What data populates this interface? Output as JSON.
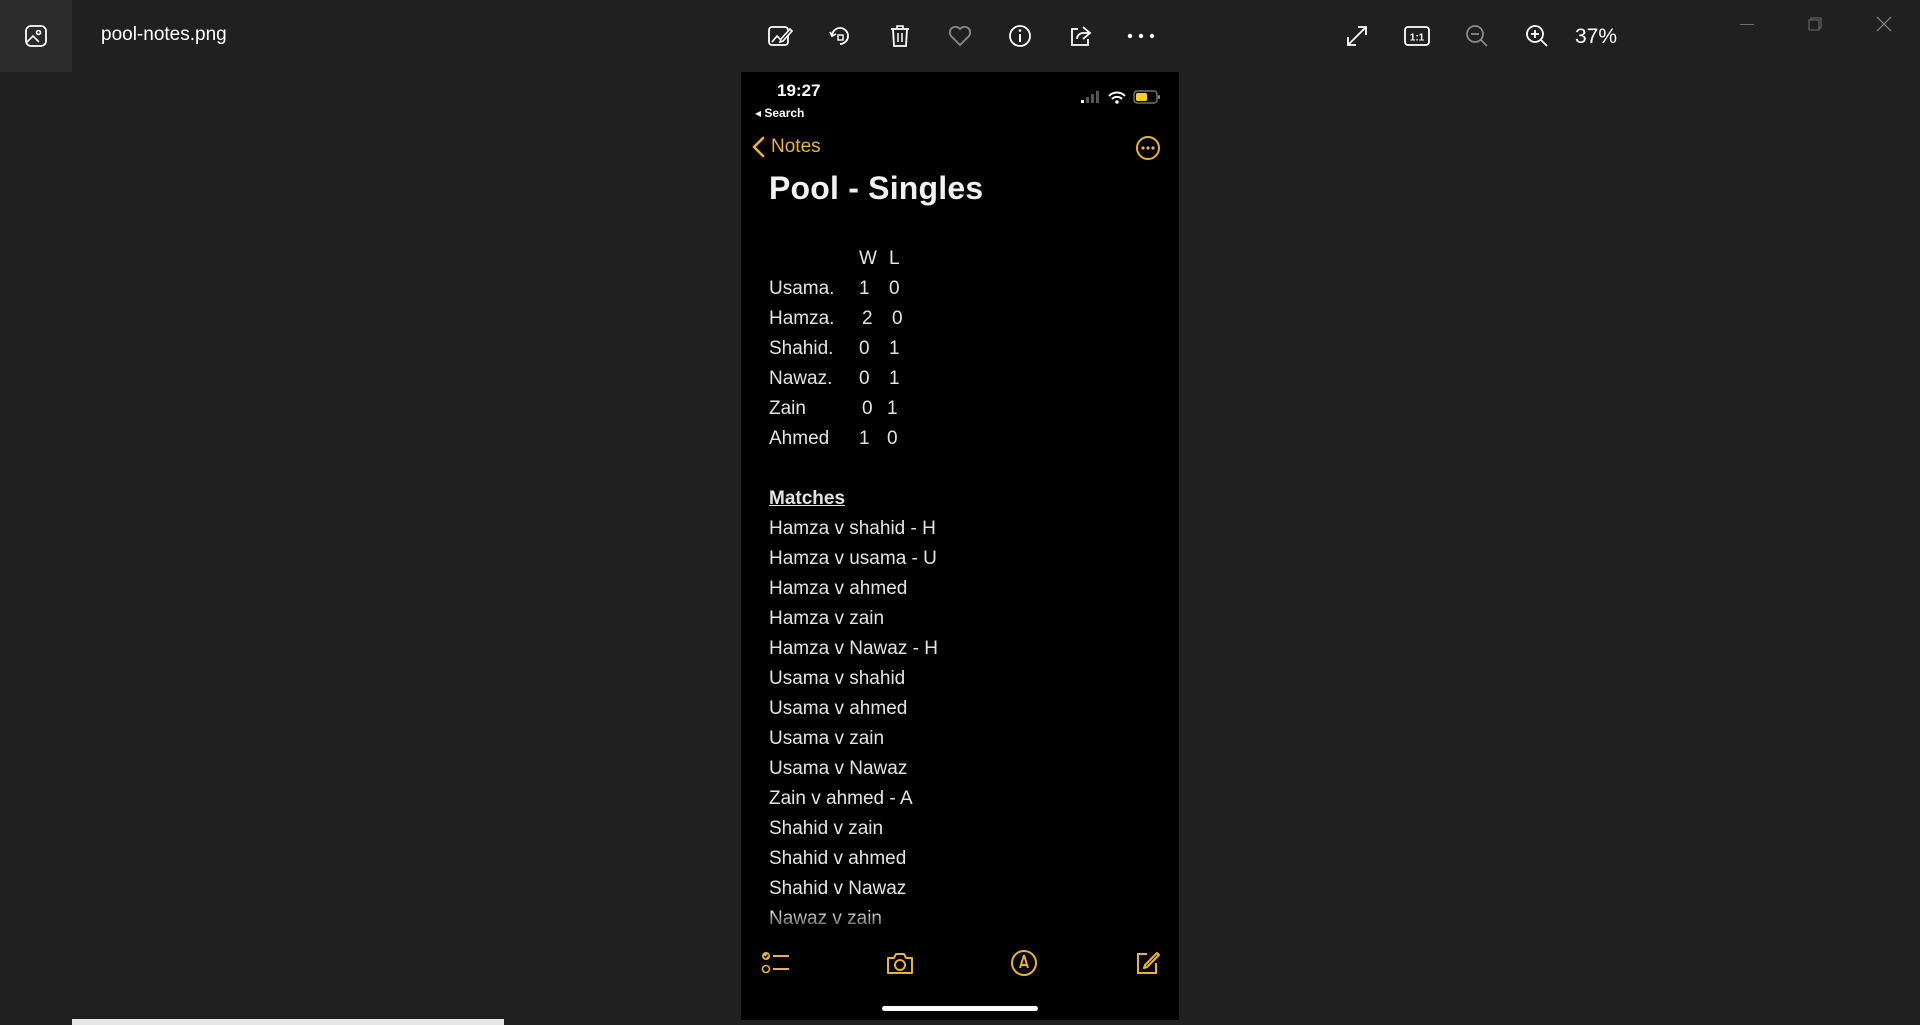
{
  "viewer": {
    "file_name": "pool-notes.png",
    "zoom": "37%",
    "toolbar_icons": [
      "edit-image-icon",
      "rotate-icon",
      "delete-icon",
      "favorite-icon",
      "info-icon",
      "share-icon",
      "more-icon"
    ],
    "view_icons": [
      "full-screen-icon",
      "actual-size-icon",
      "zoom-out-icon",
      "zoom-in-icon"
    ],
    "actual_size_label": "1:1"
  },
  "phone": {
    "status": {
      "time": "19:27",
      "back_label": "◂ Search"
    },
    "nav": {
      "back_label": "Notes"
    },
    "note": {
      "title": "Pool - Singles",
      "score_header": {
        "w": "W",
        "l": "L"
      },
      "scores": [
        {
          "name": "Usama.",
          "w": "1",
          "l": "0"
        },
        {
          "name": "Hamza.",
          "w": "2",
          "l": "0"
        },
        {
          "name": "Shahid.",
          "w": "0",
          "l": "1"
        },
        {
          "name": "Nawaz.",
          "w": "0",
          "l": "1"
        },
        {
          "name": "Zain",
          "w": "0",
          "l": "1"
        },
        {
          "name": "Ahmed",
          "w": "1",
          "l": "0"
        }
      ],
      "matches_heading": "Matches",
      "matches": [
        "Hamza v shahid - H",
        "Hamza v usama - U",
        "Hamza v ahmed",
        "Hamza v zain",
        "Hamza v Nawaz - H",
        "Usama v shahid",
        "Usama v ahmed",
        "Usama v zain",
        "Usama v Nawaz",
        "Zain v ahmed - A",
        "Shahid v zain",
        "Shahid v ahmed",
        "Shahid v Nawaz",
        "Nawaz v zain"
      ]
    },
    "accent_color": "#e8b33a"
  }
}
